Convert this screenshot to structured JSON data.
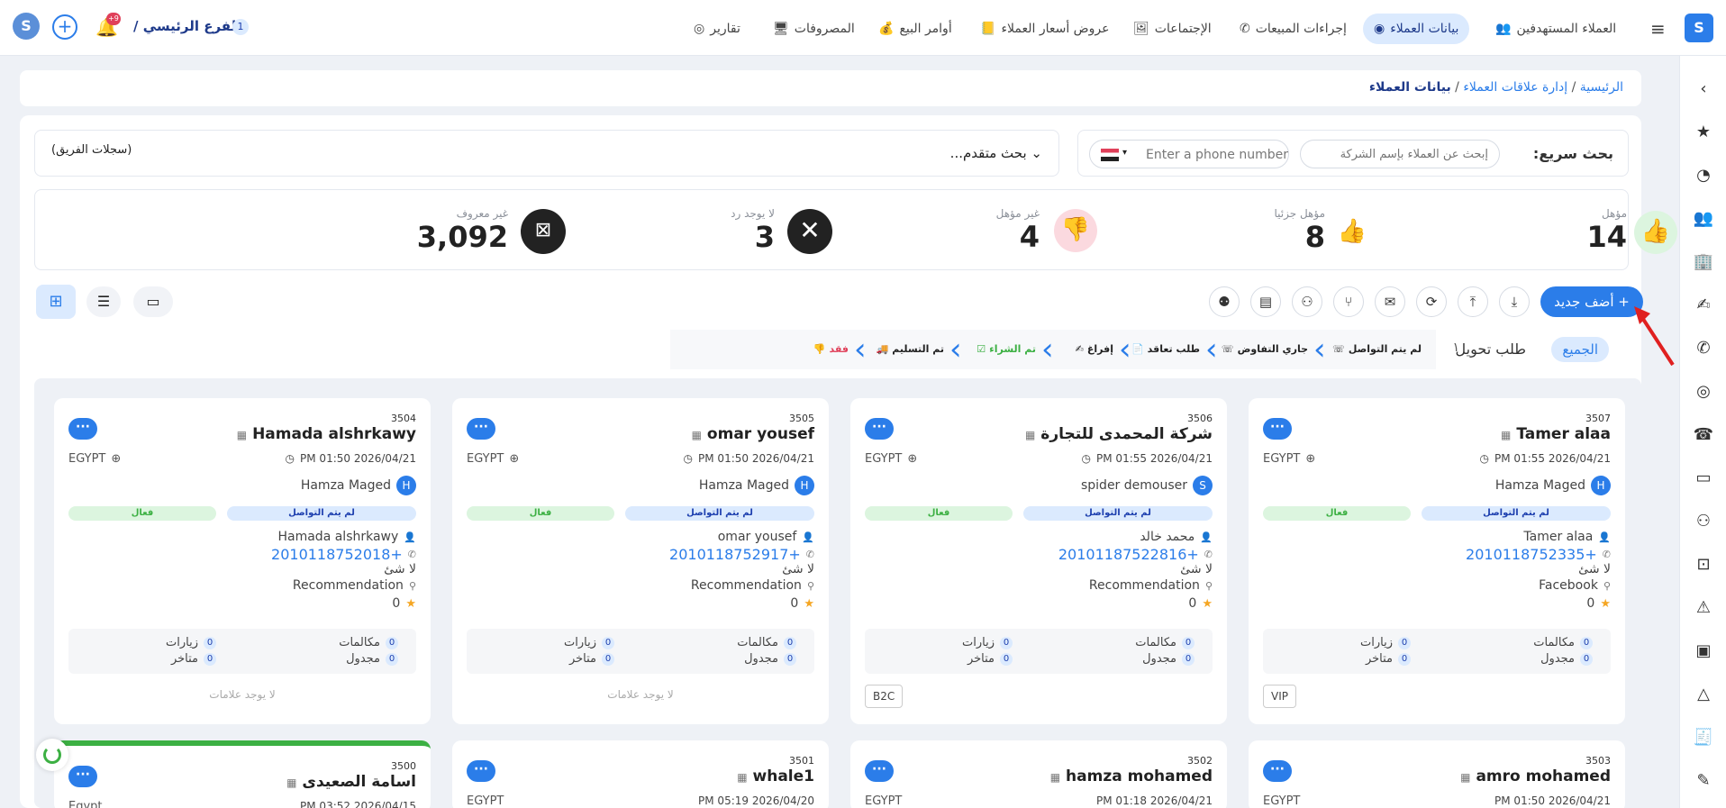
{
  "topbar": {
    "branch_count": "1",
    "branch_label": "الفرع الرئيسي /",
    "notif_badge": "+9",
    "nav": [
      {
        "label": "العملاء المستهدفين",
        "icon": "users-target-icon"
      },
      {
        "label": "بيانات العملاء",
        "icon": "customer-data-icon"
      },
      {
        "label": "إجراءات المبيعات",
        "icon": "phone-icon"
      },
      {
        "label": "الإجتماعات",
        "icon": "presentation-icon"
      },
      {
        "label": "عروض أسعار العملاء",
        "icon": "quote-icon"
      },
      {
        "label": "أوامر البيع",
        "icon": "money-bag-icon"
      },
      {
        "label": "المصروفات",
        "icon": "monitor-icon"
      },
      {
        "label": "تقارير",
        "icon": "chart-icon"
      }
    ]
  },
  "breadcrumb": {
    "home": "الرئيسية",
    "crm": "إدارة علاقات العملاء",
    "current": "بيانات العملاء",
    "sep": "/"
  },
  "search": {
    "quick_label": "بحث سريع:",
    "company_placeholder": "إبحث عن العملاء بإسم الشركة",
    "phone_placeholder": "Enter a phone number",
    "advanced": "بحث متقدم...",
    "team_records": "(سجلات الفريق)"
  },
  "stats": [
    {
      "label": "مؤهل",
      "value": "14",
      "color": "#3cb043"
    },
    {
      "label": "مؤهل جزئيا",
      "value": "8",
      "color": "#888888"
    },
    {
      "label": "غير مؤهل",
      "value": "4",
      "color": "#e0405a"
    },
    {
      "label": "لا يوجد رد",
      "value": "3",
      "color": "#222222"
    },
    {
      "label": "غير معروف",
      "value": "3,092",
      "color": "#222222"
    }
  ],
  "toolbar": {
    "add_new": "+ أضف جديد"
  },
  "pipeline": {
    "all": "الجميع",
    "conversion": "طلب تحويل",
    "count": "١",
    "stages": [
      "لم يتم التواصل",
      "جاري التفاوض",
      "طلب تعاقد",
      "إفراغ",
      "تم الشراء",
      "تم التسليم",
      "فقد"
    ]
  },
  "cards": [
    {
      "id": "3507",
      "name": "Tamer alaa",
      "date": "PM 01:55 2026/04/21",
      "country": "EGYPT",
      "owner": "Hamza Maged",
      "owner_initial": "H",
      "status": "لم يتم التواصل",
      "active": "فعال",
      "contact": "Tamer alaa",
      "phone": "+2010118752335",
      "note": "لا شئ",
      "source": "Facebook",
      "rating": "0",
      "calls": "مكالمات",
      "visits": "زيارات",
      "scheduled": "مجدول",
      "late": "متاخر",
      "zero": "0",
      "tag": "VIP"
    },
    {
      "id": "3506",
      "name": "شركة المحمدى للتجارة",
      "date": "PM 01:55 2026/04/21",
      "country": "EGYPT",
      "owner": "spider demouser",
      "owner_initial": "S",
      "status": "لم يتم التواصل",
      "active": "فعال",
      "contact": "محمد خالد",
      "phone": "+20101187522816",
      "note": "لا شئ",
      "source": "Recommendation",
      "rating": "0",
      "calls": "مكالمات",
      "visits": "زيارات",
      "scheduled": "مجدول",
      "late": "متاخر",
      "zero": "0",
      "tag": "B2C"
    },
    {
      "id": "3505",
      "name": "omar yousef",
      "date": "PM 01:50 2026/04/21",
      "country": "EGYPT",
      "owner": "Hamza Maged",
      "owner_initial": "H",
      "status": "لم يتم التواصل",
      "active": "فعال",
      "contact": "omar yousef",
      "phone": "+2010118752917",
      "note": "لا شئ",
      "source": "Recommendation",
      "rating": "0",
      "calls": "مكالمات",
      "visits": "زيارات",
      "scheduled": "مجدول",
      "late": "متاخر",
      "zero": "0",
      "tag": "لا يوجد علامات"
    },
    {
      "id": "3504",
      "name": "Hamada alshrkawy",
      "date": "PM 01:50 2026/04/21",
      "country": "EGYPT",
      "owner": "Hamza Maged",
      "owner_initial": "H",
      "status": "لم يتم التواصل",
      "active": "فعال",
      "contact": "Hamada alshrkawy",
      "phone": "+2010118752018",
      "note": "لا شئ",
      "source": "Recommendation",
      "rating": "0",
      "calls": "مكالمات",
      "visits": "زيارات",
      "scheduled": "مجدول",
      "late": "متاخر",
      "zero": "0",
      "tag": "لا يوجد علامات"
    }
  ],
  "cards_row2": [
    {
      "id": "3503",
      "name": "amro mohamed",
      "date": "PM 01:50 2026/04/21",
      "country": "EGYPT"
    },
    {
      "id": "3502",
      "name": "hamza mohamed",
      "date": "PM 01:18 2026/04/21",
      "country": "EGYPT"
    },
    {
      "id": "3501",
      "name": "whale1",
      "date": "PM 05:19 2026/04/20",
      "country": "EGYPT"
    },
    {
      "id": "3500",
      "name": "اسامة الصعيدى",
      "date": "PM 03:52 2026/04/15",
      "country": "Egypt"
    }
  ]
}
